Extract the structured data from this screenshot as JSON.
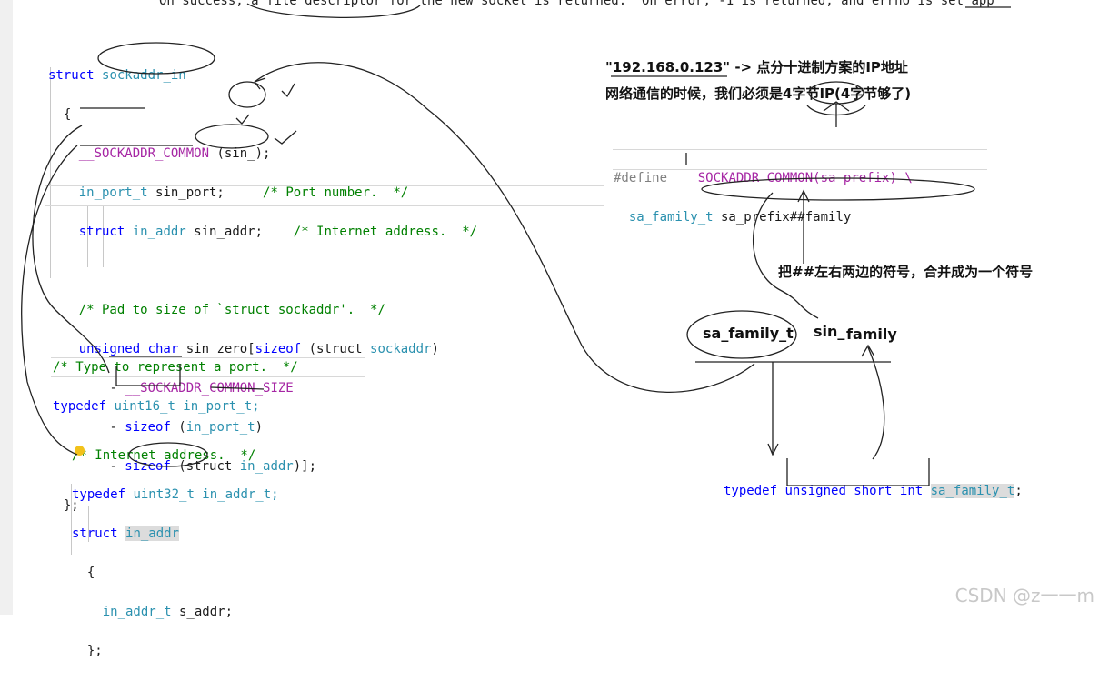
{
  "top_line": "On success, a file descriptor for the new socket is returned.  On error, -1 is returned, and errno is set app",
  "struct_block": {
    "l1_kw": "struct",
    "l1_name": "sockaddr_in",
    "l2": "{",
    "l3_macro": "__SOCKADDR_COMMON",
    "l3_rest": " (sin_);",
    "l4_type": "in_port_t",
    "l4_rest": " sin_port;",
    "l4_comment": "/* Port number.  */",
    "l5_kw": "struct",
    "l5_type": "in_addr",
    "l5_rest": " sin_addr;",
    "l5_comment": "/* Internet address.  */",
    "l6_comment": "/* Pad to size of `struct sockaddr'.  */",
    "l7_kw": "unsigned char",
    "l7_name": " sin_zero[",
    "l7_sizeof": "sizeof",
    "l7_rest": " (struct ",
    "l7_type": "sockaddr",
    "l7_close": ")",
    "l8_minus": "- ",
    "l8_macro": "__SOCKADDR_COMMON_SIZE",
    "l9_minus": "- ",
    "l9_sizeof": "sizeof",
    "l9_rest_a": " (",
    "l9_type": "in_port_t",
    "l9_rest_b": ")",
    "l10_minus": "- ",
    "l10_sizeof": "sizeof",
    "l10_rest_a": " (struct ",
    "l10_type": "in_addr",
    "l10_rest_b": ")];",
    "l11": "};"
  },
  "port_block": {
    "comment": "/* Type to represent a port.  */",
    "kw": "typedef",
    "type": " uint16_t",
    "name": " in_port_t;"
  },
  "addr_block": {
    "comment": "/* Internet address.  */",
    "kw": "typedef",
    "type": " uint32_t",
    "name": " in_addr_t;",
    "struct_kw": "struct",
    "struct_name": "in_addr",
    "open": "{",
    "field_type": "in_addr_t",
    "field_name": " s_addr;",
    "close": "};"
  },
  "define_block": {
    "directive": "#define",
    "macro": "__SOCKADDR_COMMON",
    "params": "(sa_prefix) \\",
    "l2_type": "sa_family_t",
    "l2_rest": " sa_prefix##family"
  },
  "family_typedef": {
    "kw": "typedef",
    "type": "unsigned short int",
    "name": "sa_family_t",
    "end": ";"
  },
  "notes": {
    "ip_line1": "\"192.168.0.123\" -> 点分十进制方案的IP地址",
    "ip_line2": "网络通信的时候，我们必须是4字节IP(4字节够了)",
    "merge_note": "把##左右两边的符号，合并成为一个符号",
    "hand_left": "sa_family_t",
    "hand_right_a": "sin_",
    "hand_right_b": "family"
  },
  "watermark": "CSDN @z一一m"
}
